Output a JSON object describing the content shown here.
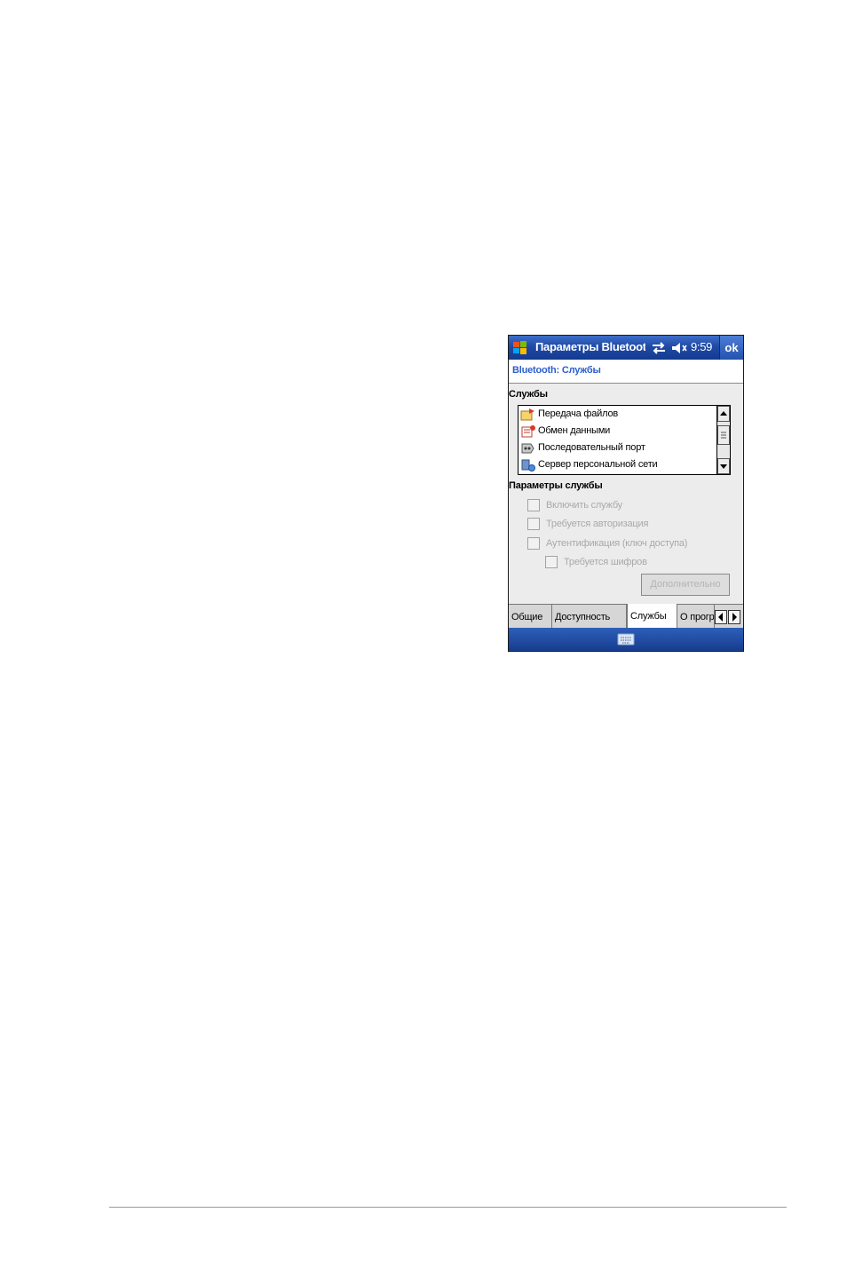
{
  "titlebar": {
    "title": "Параметры Bluetooth",
    "time": "9:59",
    "ok_label": "ok",
    "icons": [
      "windows-start-icon",
      "sync-arrows-icon",
      "volume-mute-icon"
    ]
  },
  "header": {
    "title": "Bluetooth: Службы"
  },
  "services": {
    "label": "Службы",
    "items": [
      {
        "label": "Передача файлов",
        "icon": "file-transfer-icon"
      },
      {
        "label": "Обмен данными",
        "icon": "data-exchange-icon"
      },
      {
        "label": "Последовательный порт",
        "icon": "serial-port-icon"
      },
      {
        "label": "Сервер персональной сети",
        "icon": "network-server-icon"
      }
    ]
  },
  "service_params": {
    "label": "Параметры службы",
    "enable_service": "Включить службу",
    "auth_required": "Требуется авторизация",
    "authentication": "Аутентификация (ключ доступа)",
    "encryption_required": "Требуется шифров",
    "advanced_button": "Дополнительно"
  },
  "tabs": [
    {
      "label": "Общие",
      "active": false
    },
    {
      "label": "Доступность",
      "active": false
    },
    {
      "label": "Службы",
      "active": true
    },
    {
      "label": "О программе",
      "active": false
    }
  ],
  "colors": {
    "titlebar": "#1f4aa6",
    "header_text": "#2b5fcd",
    "disabled_text": "#a9a9a9"
  }
}
